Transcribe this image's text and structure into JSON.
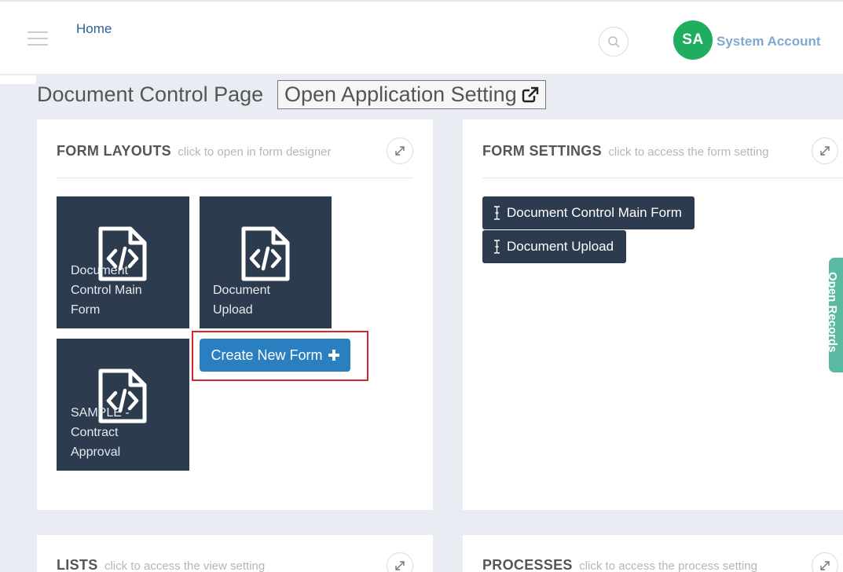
{
  "header": {
    "home_label": "Home",
    "avatar_initials": "SA",
    "account_name": "System Account"
  },
  "page": {
    "title": "Document Control Page",
    "open_setting_label": "Open Application Setting"
  },
  "form_layouts": {
    "title": "FORM LAYOUTS",
    "subtitle": "click to open in form designer",
    "tiles": [
      {
        "label": "Document Control Main Form"
      },
      {
        "label": "Document Upload"
      },
      {
        "label": "SAMPLE - Contract Approval"
      }
    ],
    "create_label": "Create New Form"
  },
  "form_settings": {
    "title": "FORM SETTINGS",
    "subtitle": "click to access the form setting",
    "items": [
      {
        "label": "Document Control Main Form"
      },
      {
        "label": "Document Upload"
      }
    ]
  },
  "lists": {
    "title": "LISTS",
    "subtitle": "click to access the view setting"
  },
  "processes": {
    "title": "PROCESSES",
    "subtitle": "click to access the process setting"
  },
  "side_tab_label": "Open Records",
  "colors": {
    "tile_bg": "#2d3b4f",
    "primary_button": "#2a7fc1",
    "avatar_bg": "#1fae5f",
    "highlight_border": "#d9262c",
    "side_tab": "#59b9a1"
  },
  "icons": {
    "menu": "hamburger-icon",
    "search": "search-icon",
    "external": "external-link-icon",
    "expand": "expand-icon",
    "document": "code-file-icon",
    "text_cursor": "text-cursor-icon",
    "plus": "plus-icon"
  }
}
